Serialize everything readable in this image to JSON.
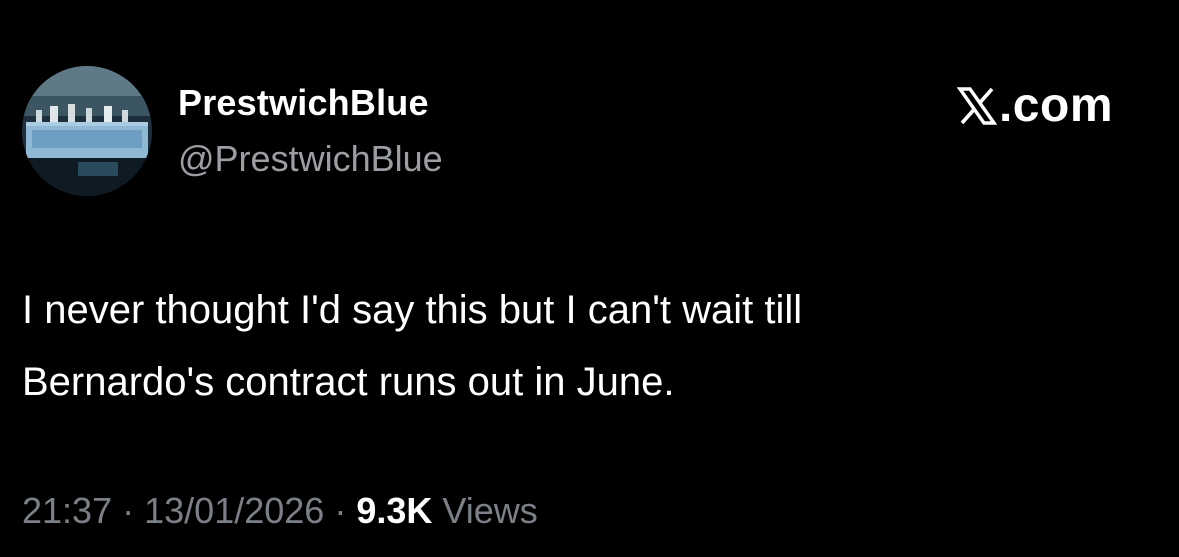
{
  "author": {
    "display_name": "PrestwichBlue",
    "handle": "@PrestwichBlue",
    "avatar_icon": "profile-avatar-icon"
  },
  "brand": {
    "label": ".com",
    "icon": "x-logo-icon"
  },
  "tweet": {
    "lines": [
      "I never thought I'd say this but I can't wait till",
      "Bernardo's contract runs out in June."
    ]
  },
  "meta": {
    "time": "21:37",
    "separator": "·",
    "date": "13/01/2026",
    "views_count": "9.3K",
    "views_label": "Views"
  },
  "colors": {
    "background": "#000000",
    "primary_text": "#ffffff",
    "secondary_text": "#7b8087"
  }
}
